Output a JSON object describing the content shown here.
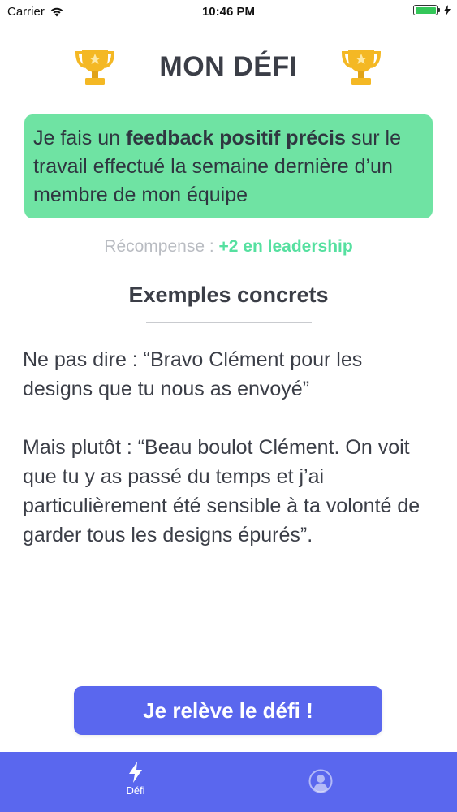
{
  "status_bar": {
    "carrier": "Carrier",
    "time": "10:46 PM",
    "battery_level": 1.0,
    "battery_color": "#34c759"
  },
  "header": {
    "title": "MON DÉFI",
    "left_icon": "trophy-icon",
    "right_icon": "trophy-icon"
  },
  "challenge": {
    "text_before": "Je fais un ",
    "text_bold": "feedback positif précis",
    "text_after": " sur le travail effectué la semaine dernière d’un membre de mon équipe",
    "background": "#6fe3a3"
  },
  "reward": {
    "label": "Récompense : ",
    "value": "+2 en leadership",
    "value_color": "#56e0a0"
  },
  "examples": {
    "title": "Exemples concrets",
    "dont_say": "Ne pas dire : “Bravo Clément pour les designs que tu nous as envoyé”",
    "say_instead": "Mais plutôt : “Beau boulot Clément. On voit que tu y as passé du temps et j’ai particulièrement été sensible à ta volonté de garder tous les designs épurés”."
  },
  "cta": {
    "label": "Je relève le défi !",
    "color": "#5a67ee"
  },
  "tab_bar": {
    "background": "#5a67ee",
    "tabs": [
      {
        "label": "Défi",
        "icon": "lightning-icon",
        "selected": true
      },
      {
        "label": "",
        "icon": "profile-icon",
        "selected": false
      }
    ]
  }
}
